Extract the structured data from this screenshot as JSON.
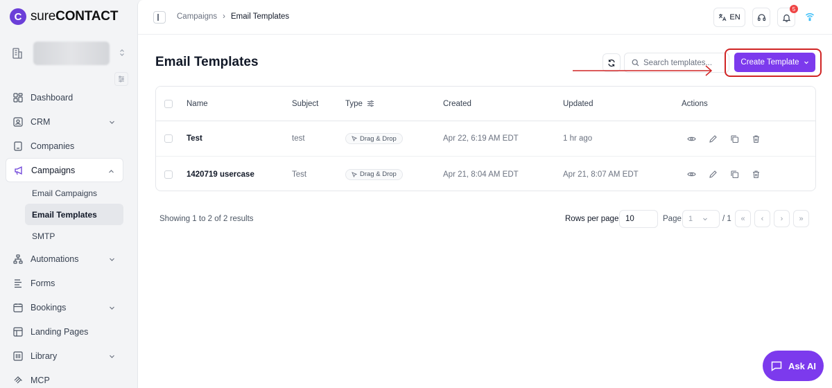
{
  "brand": {
    "logo_letter": "C",
    "name_light": "sure",
    "name_bold": "CONTACT",
    "accent": "#7c3aed"
  },
  "sidebar": {
    "items": [
      {
        "label": "Dashboard",
        "icon": "dashboard-icon"
      },
      {
        "label": "CRM",
        "icon": "contact-card-icon",
        "expandable": true
      },
      {
        "label": "Companies",
        "icon": "building-icon"
      },
      {
        "label": "Campaigns",
        "icon": "megaphone-icon",
        "expandable": true,
        "active": true,
        "children": [
          {
            "label": "Email Campaigns"
          },
          {
            "label": "Email Templates",
            "active": true
          },
          {
            "label": "SMTP"
          }
        ]
      },
      {
        "label": "Automations",
        "icon": "flow-icon",
        "expandable": true
      },
      {
        "label": "Forms",
        "icon": "form-icon"
      },
      {
        "label": "Bookings",
        "icon": "calendar-icon",
        "expandable": true
      },
      {
        "label": "Landing Pages",
        "icon": "layout-icon"
      },
      {
        "label": "Library",
        "icon": "library-icon",
        "expandable": true
      },
      {
        "label": "MCP",
        "icon": "mcp-icon"
      }
    ]
  },
  "topbar": {
    "breadcrumb": [
      "Campaigns",
      "Email Templates"
    ],
    "language": "EN",
    "notifications_count": "5"
  },
  "page": {
    "title": "Email Templates",
    "search_placeholder": "Search templates...",
    "create_label": "Create Template"
  },
  "table": {
    "headers": {
      "name": "Name",
      "subject": "Subject",
      "type": "Type",
      "created": "Created",
      "updated": "Updated",
      "actions": "Actions"
    },
    "rows": [
      {
        "name": "Test",
        "subject": "test",
        "type": "Drag & Drop",
        "created": "Apr 22, 6:19 AM EDT",
        "updated": "1 hr ago"
      },
      {
        "name": "1420719 usercase",
        "subject": "Test",
        "type": "Drag & Drop",
        "created": "Apr 21, 8:04 AM EDT",
        "updated": "Apr 21, 8:07 AM EDT"
      }
    ]
  },
  "pagination": {
    "showing": "Showing 1 to 2 of 2 results",
    "rows_per_page_label": "Rows per page",
    "rows_per_page": "10",
    "page_label": "Page",
    "page": "1",
    "total": "/ 1",
    "first": "«",
    "prev": "‹",
    "next": "›",
    "last": "»"
  },
  "ask_ai": "Ask AI"
}
